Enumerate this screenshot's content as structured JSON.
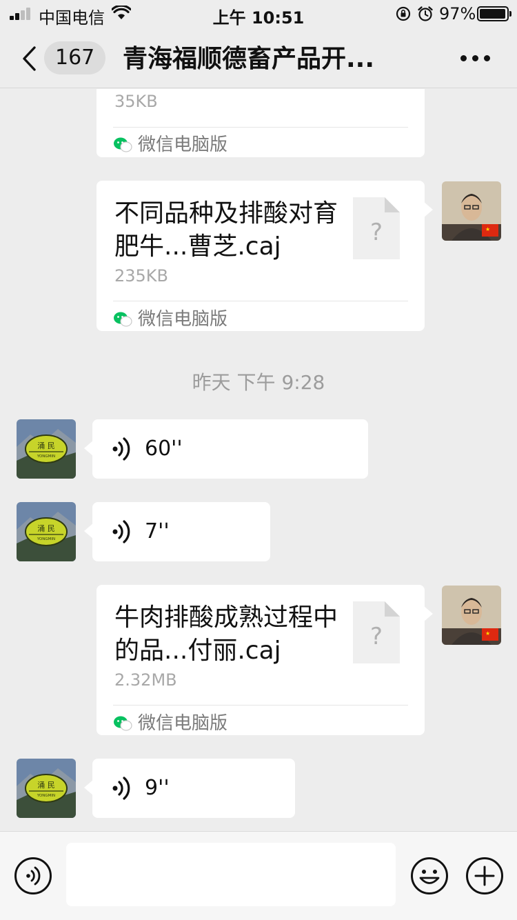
{
  "status_bar": {
    "carrier": "中国电信",
    "time": "上午 10:51",
    "battery_percent": "97%",
    "battery_level": 0.97
  },
  "nav": {
    "back_icon": "chevron-left-icon",
    "unread_count": "167",
    "title": "青海福顺德畜产品开...",
    "more_icon": "more-dots-icon"
  },
  "messages": {
    "file_1": {
      "size": "35KB",
      "source": "微信电脑版"
    },
    "file_2": {
      "name": "不同品种及排酸对育肥牛...曹芝.caj",
      "size": "235KB",
      "source": "微信电脑版"
    },
    "timestamp_1": "昨天 下午 9:28",
    "voice_1": {
      "duration": "60''"
    },
    "voice_2": {
      "duration": "7''"
    },
    "file_3": {
      "name": "牛肉排酸成熟过程中的品...付丽.caj",
      "size": "2.32MB",
      "source": "微信电脑版"
    },
    "voice_3": {
      "duration": "9''"
    }
  },
  "avatars": {
    "self_flag_icon": "china-flag-icon",
    "other_logo_text": "涌 民",
    "other_logo_subtext": "YONGMIN"
  },
  "input_bar": {
    "voice_icon": "voice-toggle-icon",
    "text_value": "",
    "emoji_icon": "emoji-icon",
    "plus_icon": "plus-icon"
  },
  "colors": {
    "background": "#ededed",
    "bubble": "#ffffff",
    "muted_text": "#a8a8a8",
    "wechat_green": "#07c160"
  }
}
